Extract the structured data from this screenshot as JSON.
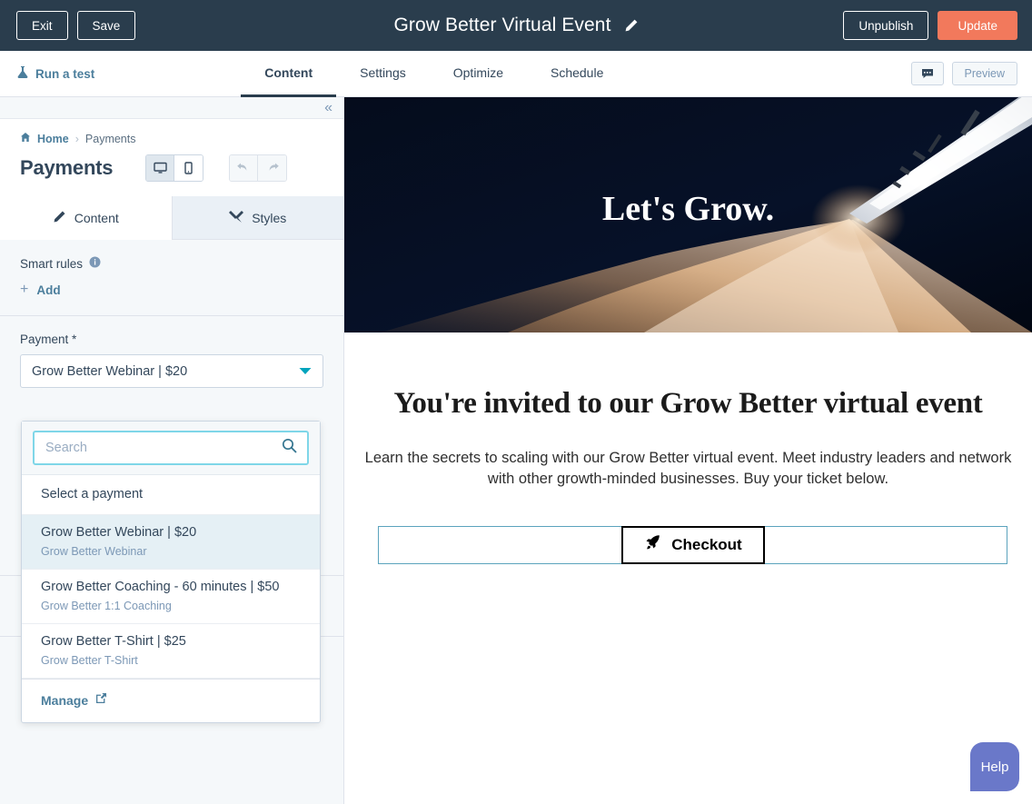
{
  "topbar": {
    "exit_label": "Exit",
    "save_label": "Save",
    "title": "Grow Better Virtual Event",
    "edit_icon": "pencil-icon",
    "unpublish_label": "Unpublish",
    "update_label": "Update",
    "update_color": "#f2795c",
    "background": "#2a3d4d"
  },
  "navbar": {
    "run_test_label": "Run a test",
    "run_test_icon": "flask-icon",
    "tabs": [
      {
        "label": "Content",
        "active": true
      },
      {
        "label": "Settings",
        "active": false
      },
      {
        "label": "Optimize",
        "active": false
      },
      {
        "label": "Schedule",
        "active": false
      }
    ],
    "comment_icon": "comment-icon",
    "preview_label": "Preview"
  },
  "sidebar": {
    "collapse_icon": "double-chevron-left-icon",
    "breadcrumb": {
      "home_label": "Home",
      "home_icon": "home-icon",
      "separator": "›",
      "current_label": "Payments"
    },
    "title": "Payments",
    "device_toggle": [
      {
        "name": "desktop-icon",
        "active": true
      },
      {
        "name": "mobile-icon",
        "active": false
      }
    ],
    "history": [
      {
        "name": "undo-icon"
      },
      {
        "name": "redo-icon"
      }
    ],
    "tabs": [
      {
        "label": "Content",
        "icon": "pencil-icon",
        "active": true
      },
      {
        "label": "Styles",
        "icon": "brush-icon",
        "active": false
      }
    ],
    "smart_rules": {
      "label": "Smart rules",
      "info_icon": "info-icon",
      "add_label": "Add",
      "add_icon": "plus-icon"
    },
    "payment_field": {
      "label": "Payment *",
      "selected_value": "Grow Better Webinar | $20",
      "caret_icon": "chevron-down-icon"
    }
  },
  "dropdown": {
    "search_placeholder": "Search",
    "search_value": "",
    "search_icon": "search-icon",
    "options": [
      {
        "title": "Select a payment",
        "sub": "",
        "selected": false
      },
      {
        "title": "Grow Better Webinar | $20",
        "sub": "Grow Better Webinar",
        "selected": true
      },
      {
        "title": "Grow Better Coaching - 60 minutes | $50",
        "sub": "Grow Better 1:1 Coaching",
        "selected": false
      },
      {
        "title": "Grow Better T-Shirt | $25",
        "sub": "Grow Better T-Shirt",
        "selected": false
      }
    ],
    "manage_label": "Manage",
    "manage_icon": "external-link-icon"
  },
  "preview": {
    "hero_title": "Let's Grow.",
    "hero_image": "rocket-launch-photo",
    "invite_title": "You're invited to our Grow Better virtual event",
    "invite_body": "Learn the secrets to scaling with our Grow Better virtual event. Meet industry leaders and network with other growth-minded businesses. Buy your ticket below.",
    "checkout_label": "Checkout",
    "checkout_icon": "rocket-icon"
  },
  "help": {
    "label": "Help",
    "color": "#6a78c9"
  }
}
